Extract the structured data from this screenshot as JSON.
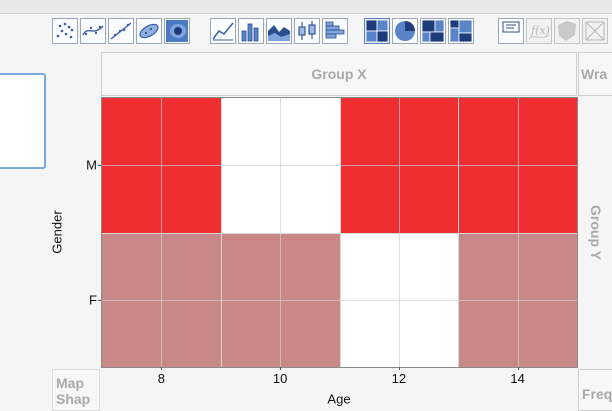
{
  "toolbar": {
    "icons": [
      "points-icon",
      "smoother-icon",
      "line-of-fit-icon",
      "ellipse-icon",
      "contour-icon",
      "line-icon",
      "bar-icon",
      "area-icon",
      "box-plot-icon",
      "histogram-icon",
      "heatmap-icon",
      "pie-icon",
      "treemap-icon",
      "mosaic-icon",
      "caption-box-icon",
      "formula-icon",
      "map-shape-icon",
      "close-icon"
    ],
    "selected": "heatmap-icon"
  },
  "zones": {
    "group_x": "Group X",
    "wrap": "Wra",
    "group_y": "Group Y",
    "map_line1": "Map",
    "map_line2": "Shap",
    "freq": "Freq"
  },
  "colors": {
    "male": "#ef2e31",
    "female": "#c98888",
    "empty": "#ffffff"
  },
  "chart_data": {
    "type": "heatmap",
    "x": [
      8,
      10,
      12,
      14
    ],
    "x_tick_labels": [
      "8",
      "10",
      "12",
      "14"
    ],
    "y": [
      "M",
      "F"
    ],
    "xlabel": "Age",
    "ylabel": "Gender",
    "cells": [
      {
        "x": 8,
        "y": "M",
        "filled": true
      },
      {
        "x": 10,
        "y": "M",
        "filled": false
      },
      {
        "x": 12,
        "y": "M",
        "filled": true
      },
      {
        "x": 14,
        "y": "M",
        "filled": true
      },
      {
        "x": 8,
        "y": "F",
        "filled": true
      },
      {
        "x": 10,
        "y": "F",
        "filled": true
      },
      {
        "x": 12,
        "y": "F",
        "filled": false
      },
      {
        "x": 14,
        "y": "F",
        "filled": true
      }
    ],
    "grid": true
  }
}
